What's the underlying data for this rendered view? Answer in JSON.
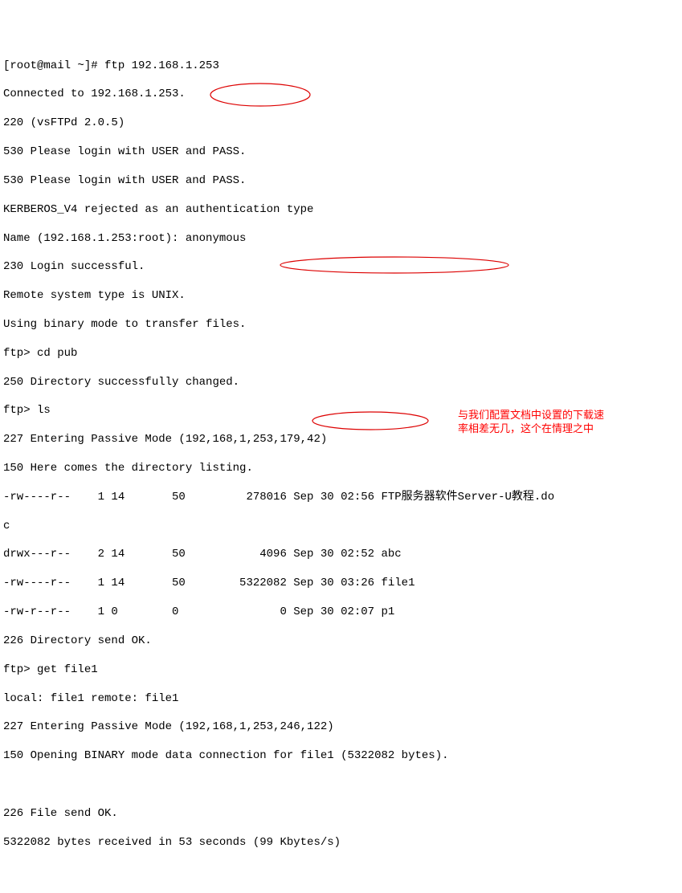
{
  "lines": {
    "l00": "[root@mail ~]# ftp 192.168.1.253",
    "l01": "Connected to 192.168.1.253.",
    "l02": "220 (vsFTPd 2.0.5)",
    "l03": "530 Please login with USER and PASS.",
    "l04": "530 Please login with USER and PASS.",
    "l05": "KERBEROS_V4 rejected as an authentication type",
    "l06": "Name (192.168.1.253:root): anonymous",
    "l07": "230 Login successful.",
    "l08": "Remote system type is UNIX.",
    "l09": "Using binary mode to transfer files.",
    "l10": "ftp> cd pub",
    "l11": "250 Directory successfully changed.",
    "l12": "ftp> ls",
    "l13": "227 Entering Passive Mode (192,168,1,253,179,42)",
    "l14": "150 Here comes the directory listing.",
    "l15": "-rw----r--    1 14       50         278016 Sep 30 02:56 FTP服务器软件Server-U教程.do",
    "l16": "c",
    "l17": "drwx---r--    2 14       50           4096 Sep 30 02:52 abc",
    "l18": "-rw----r--    1 14       50        5322082 Sep 30 03:26 file1",
    "l19": "-rw-r--r--    1 0        0               0 Sep 30 02:07 p1",
    "l20": "226 Directory send OK.",
    "l21": "ftp> get file1",
    "l22": "local: file1 remote: file1",
    "l23": "227 Entering Passive Mode (192,168,1,253,246,122)",
    "l24": "150 Opening BINARY mode data connection for file1 (5322082 bytes).",
    "l25": "",
    "l26": "",
    "l27": "226 File send OK.",
    "l28": "5322082 bytes received in 53 seconds (99 Kbytes/s)"
  },
  "note": {
    "l1": "与我们配置文档中设置的下载速",
    "l2": "率相差无几，这个在情理之中"
  }
}
